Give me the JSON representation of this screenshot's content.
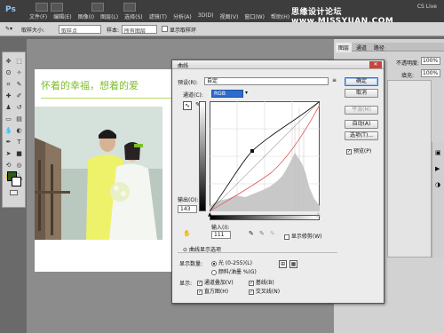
{
  "app": {
    "logo": "Ps",
    "cs_live": "CS Live"
  },
  "watermark": "思缘设计论坛 www.MISSYUAN.COM",
  "menu": [
    "文件(F)",
    "编辑(E)",
    "图像(I)",
    "图层(L)",
    "选择(S)",
    "滤镜(T)",
    "分析(A)",
    "3D(D)",
    "视图(V)",
    "窗口(W)",
    "帮助(H)"
  ],
  "options_bar": {
    "sample_size_label": "取样大小:",
    "sample_size_value": "取样点",
    "sample_label": "样本:",
    "sample_value": "所有图层",
    "show_ring_label": "显示取样环"
  },
  "document": {
    "title": "怀着的幸福，想着的爱"
  },
  "right_panel": {
    "tabs": [
      "图层",
      "通道",
      "路径"
    ],
    "opacity_label": "不透明度:",
    "opacity_value": "100%",
    "fill_label": "填充:",
    "fill_value": "100%"
  },
  "curves": {
    "dialog_title": "曲线",
    "preset_label": "预设(R):",
    "preset_value": "自定",
    "channel_label": "通道(C):",
    "channel_value": "RGB",
    "output_label": "输出(O):",
    "output_value": "143",
    "input_label": "输入(I):",
    "input_value": "111",
    "show_clipping_label": "显示修剪(W)",
    "display_options_label": "曲线显示选项",
    "show_amount_label": "显示数量:",
    "light_label": "光 (0-255)(L)",
    "pigment_label": "颜料/油墨 %(G)",
    "show_label": "显示:",
    "channel_overlays_label": "通道叠加(V)",
    "baseline_label": "基线(B)",
    "histogram_label": "直方图(H)",
    "intersection_label": "交叉线(N)",
    "buttons": {
      "ok": "确定",
      "cancel": "取消",
      "smooth": "平滑(M)",
      "auto": "自动(A)",
      "options": "选项(T)..."
    },
    "preview_label": "预览(P)"
  },
  "colors": {
    "foreground": "#2e5a1e",
    "background": "#ffffff",
    "accent": "#7fbe2a"
  }
}
